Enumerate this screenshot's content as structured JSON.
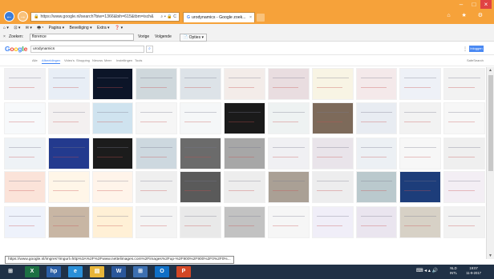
{
  "browser": {
    "address": "https://www.google.nl/search?biw=1366&bih=615&tbm=isch&",
    "address_tail": "⌕ ▾ 🔒 C",
    "tab_title": "urodynamics - Google zoek...",
    "tab_close": "×",
    "window_controls": [
      "–",
      "□",
      "×"
    ],
    "back": "←",
    "forward": "→",
    "tr_icons": "⌂ ★ ⚙"
  },
  "menubar": {
    "items": [
      "⌂ ▾",
      "⊡ ▾",
      "✉ ▾",
      "🖶 ▾",
      "Pagina ▾",
      "Beveiliging ▾",
      "Extra ▾",
      "❓ ▾"
    ]
  },
  "findbar": {
    "close": "×",
    "label": "Zoeken:",
    "value": "florence",
    "prev": "Vorige",
    "next": "Volgende",
    "options": "📄 Opties ▾"
  },
  "google": {
    "logo_letters": [
      "G",
      "o",
      "o",
      "g",
      "l",
      "e"
    ],
    "logo_colors": [
      "#4285f4",
      "#ea4335",
      "#fbbc05",
      "#4285f4",
      "#34a853",
      "#ea4335"
    ],
    "query": "urodynamics",
    "search_btn": "⌕",
    "apps": "⋮⋮",
    "signin": "Inloggen",
    "tabs": [
      "Alle",
      "Afbeeldingen",
      "Video's",
      "Shopping",
      "Nieuws",
      "Meer",
      "Instellingen",
      "Tools"
    ],
    "settings": "SafeSearch"
  },
  "status_url": "https://www.google.nl/imgres?imgurl=http%3A%2F%2Fwww.nettelimages.com%2Fimages%2Fup-%2F900%2F900%2F0%2F0%...",
  "taskbar": {
    "items": [
      {
        "label": "⊞",
        "color": "#203146"
      },
      {
        "label": "X",
        "color": "#1d7044"
      },
      {
        "label": "hp",
        "color": "#2b5fa6"
      },
      {
        "label": "e",
        "color": "#2a8fd8"
      },
      {
        "label": "▤",
        "color": "#e7b53a"
      },
      {
        "label": "W",
        "color": "#2b579a"
      },
      {
        "label": "⊞",
        "color": "#3c6fb0"
      },
      {
        "label": "O",
        "color": "#0f6fc6"
      },
      {
        "label": "P",
        "color": "#d24726"
      }
    ],
    "tray": "⌨ ◂ ▴ 🔊",
    "lang_top": "NLD",
    "lang_bottom": "INTL",
    "time": "19:07",
    "date": "11-9-2017"
  },
  "thumb_colors": [
    [
      "#f1f1f4",
      "#e8eef6",
      "#0c1528",
      "#cfd8dc",
      "#dde3e8",
      "#f3ece9",
      "#e9dde0",
      "#f8f4e4",
      "#f4e9ea",
      "#eef1f7",
      "#f2f2f2"
    ],
    [
      "#f7f9fb",
      "#f3f0f0",
      "#cfe3ef",
      "#f6f6f6",
      "#f5f7f8",
      "#1a1a1a",
      "#eef2f2",
      "#7d6a5a",
      "#e8ecf2",
      "#f2f2f2",
      "#f7f7f7"
    ],
    [
      "#eef2f6",
      "#233a8e",
      "#1c1c1c",
      "#cdd8df",
      "#6b6b6b",
      "#a7a7a7",
      "#f0f0f3",
      "#e9e4ea",
      "#ecf0f4",
      "#f7f7f7",
      "#efefef"
    ],
    [
      "#fbe3d9",
      "#fff6e8",
      "#fff4ea",
      "#efefef",
      "#5a5a5a",
      "#ededed",
      "#aaa095",
      "#ededee",
      "#bac9cd",
      "#1d3d7a",
      "#f3eef4"
    ],
    [
      "#eef2fb",
      "#c8b6a4",
      "#fff0d6",
      "#f4f4f4",
      "#e9e9e9",
      "#c2c2c2",
      "#f6f6f6",
      "#f0eef8",
      "#eae5ef",
      "#d7d1c6",
      "#f2f2f2"
    ]
  ]
}
